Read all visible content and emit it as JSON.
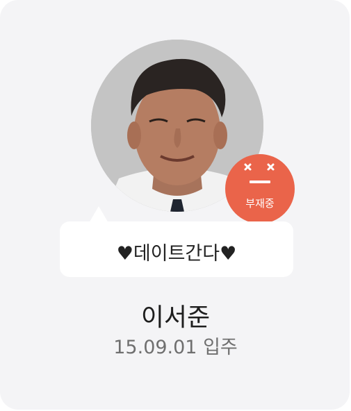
{
  "profile": {
    "status_message": "♥데이트간다♥",
    "status_badge": "부재중",
    "name": "이서준",
    "move_in": "15.09.01 입주"
  },
  "colors": {
    "card_background": "#f4f4f6",
    "status_badge": "#ea644a",
    "bubble": "#ffffff"
  },
  "icons": {
    "status_face": "sleeping-face-icon"
  }
}
